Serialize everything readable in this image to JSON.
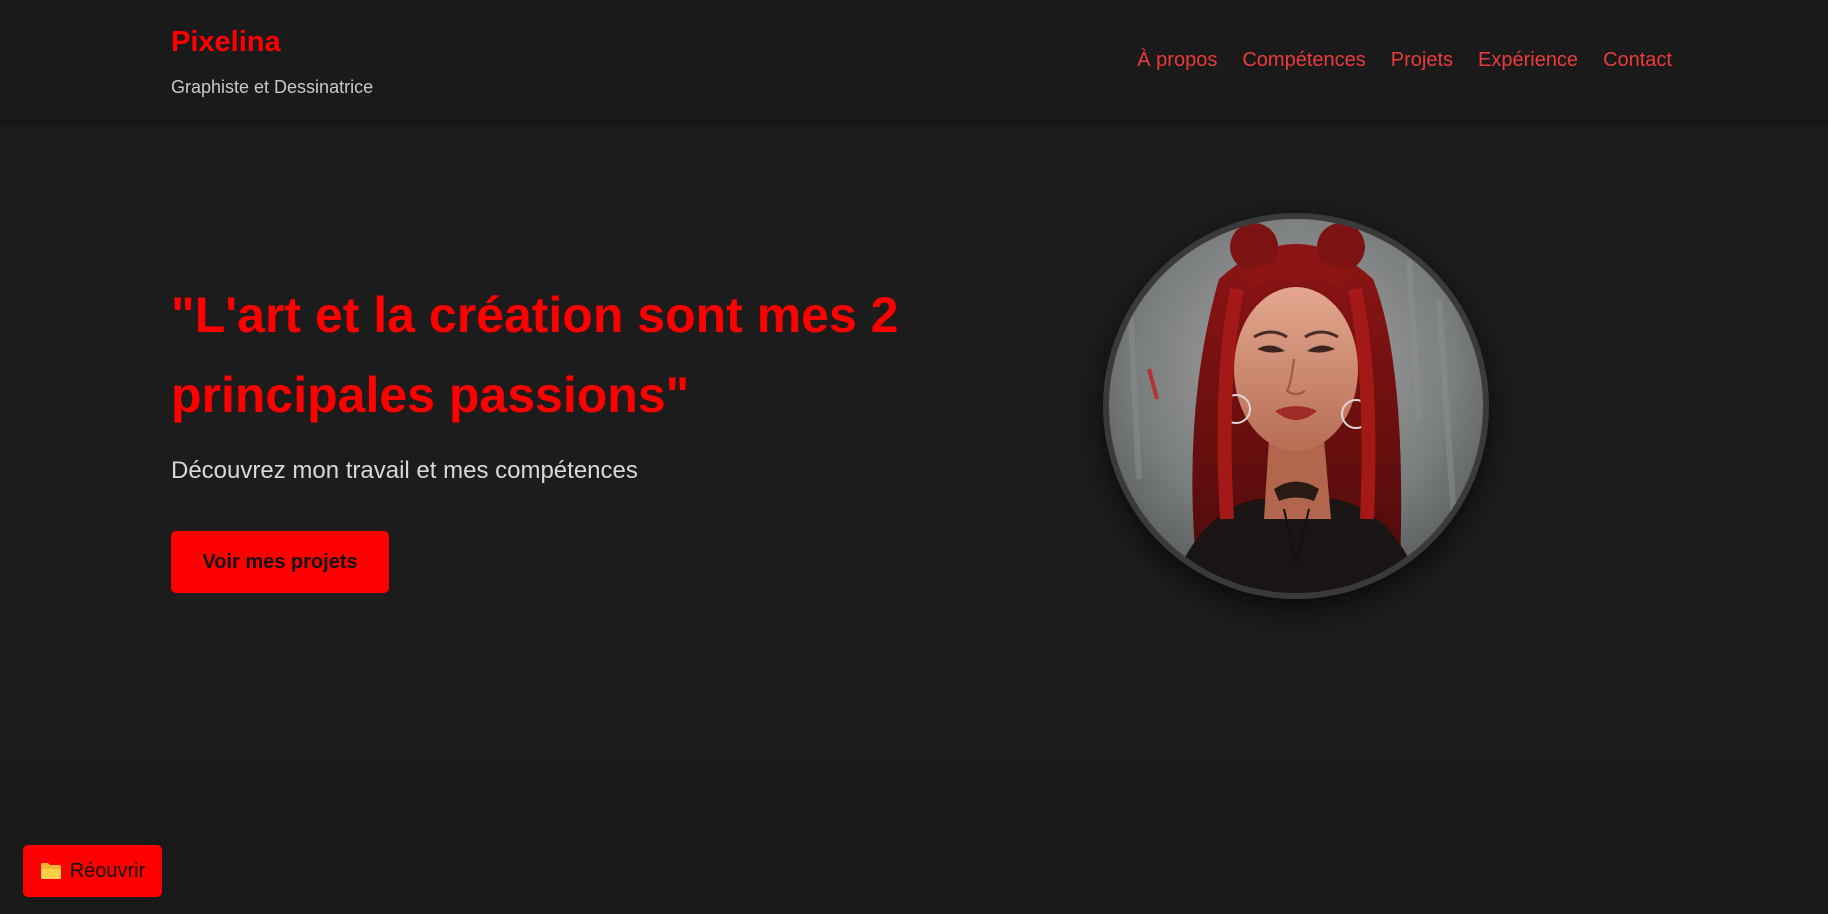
{
  "header": {
    "brand": "Pixelina",
    "tagline": "Graphiste et Dessinatrice",
    "nav": [
      "À propos",
      "Compétences",
      "Projets",
      "Expérience",
      "Contact"
    ]
  },
  "hero": {
    "headline": "\"L'art et la création sont mes 2 principales passions\"",
    "subtext": "Découvrez mon travail et mes compétences",
    "cta_label": "Voir mes projets",
    "portrait_alt": "portrait"
  },
  "floating": {
    "reopen_label": "Réouvrir",
    "reopen_icon": "folder-icon"
  },
  "colors": {
    "accent": "#ff0000",
    "nav_link": "#ea3b3b",
    "background": "#1c1c1c",
    "header_bg": "#1a1a1a"
  }
}
